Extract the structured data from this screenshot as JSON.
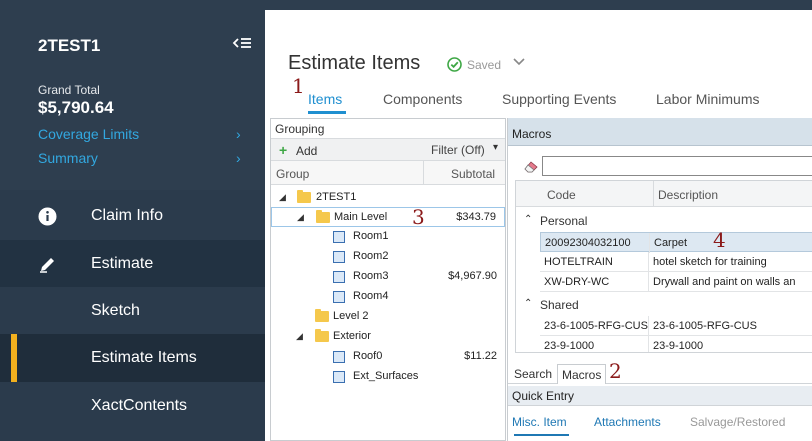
{
  "sidebar": {
    "claim_title": "2TEST1",
    "grand_total_label": "Grand Total",
    "grand_total_value": "$5,790.64",
    "links": [
      {
        "label": "Coverage Limits",
        "chevron": "›"
      },
      {
        "label": "Summary",
        "chevron": "›"
      }
    ],
    "nav": [
      {
        "label": "Claim Info",
        "icon": "info-icon"
      },
      {
        "label": "Estimate",
        "icon": "pencil-icon"
      },
      {
        "label": "Sketch"
      },
      {
        "label": "Estimate Items"
      },
      {
        "label": "XactContents"
      }
    ],
    "accent_color": "#f2b01e"
  },
  "header": {
    "title": "Estimate Items",
    "saved_label": "Saved"
  },
  "tabs": [
    "Items",
    "Components",
    "Supporting Events",
    "Labor Minimums"
  ],
  "markers": [
    "1",
    "2",
    "3",
    "4"
  ],
  "grouping": {
    "title": "Grouping",
    "add_label": "Add",
    "filter_label": "Filter (Off)",
    "columns": [
      "Group",
      "Subtotal"
    ],
    "tree": [
      {
        "label": "2TEST1",
        "value": ""
      },
      {
        "label": "Main Level",
        "value": "$343.79"
      },
      {
        "label": "Room1",
        "value": ""
      },
      {
        "label": "Room2",
        "value": ""
      },
      {
        "label": "Room3",
        "value": "$4,967.90"
      },
      {
        "label": "Room4",
        "value": ""
      },
      {
        "label": "Level 2",
        "value": ""
      },
      {
        "label": "Exterior",
        "value": ""
      },
      {
        "label": "Roof0",
        "value": "$11.22"
      },
      {
        "label": "Ext_Surfaces",
        "value": ""
      }
    ]
  },
  "macros": {
    "title": "Macros",
    "search_value": "",
    "columns": [
      "Code",
      "Description"
    ],
    "groups": [
      {
        "name": "Personal",
        "rows": [
          {
            "code": "20092304032100",
            "desc": "Carpet"
          },
          {
            "code": "HOTELTRAIN",
            "desc": "hotel sketch for training"
          },
          {
            "code": "XW-DRY-WC",
            "desc": "Drywall and paint on walls an"
          }
        ]
      },
      {
        "name": "Shared",
        "rows": [
          {
            "code": "23-6-1005-RFG-CUS",
            "desc": "23-6-1005-RFG-CUS"
          },
          {
            "code": "23-9-1000",
            "desc": "23-9-1000"
          }
        ]
      }
    ],
    "bottom_tabs": [
      "Search",
      "Macros"
    ]
  },
  "quick_entry": {
    "title": "Quick Entry",
    "tabs": [
      "Misc. Item",
      "Attachments",
      "Salvage/Restored"
    ]
  }
}
